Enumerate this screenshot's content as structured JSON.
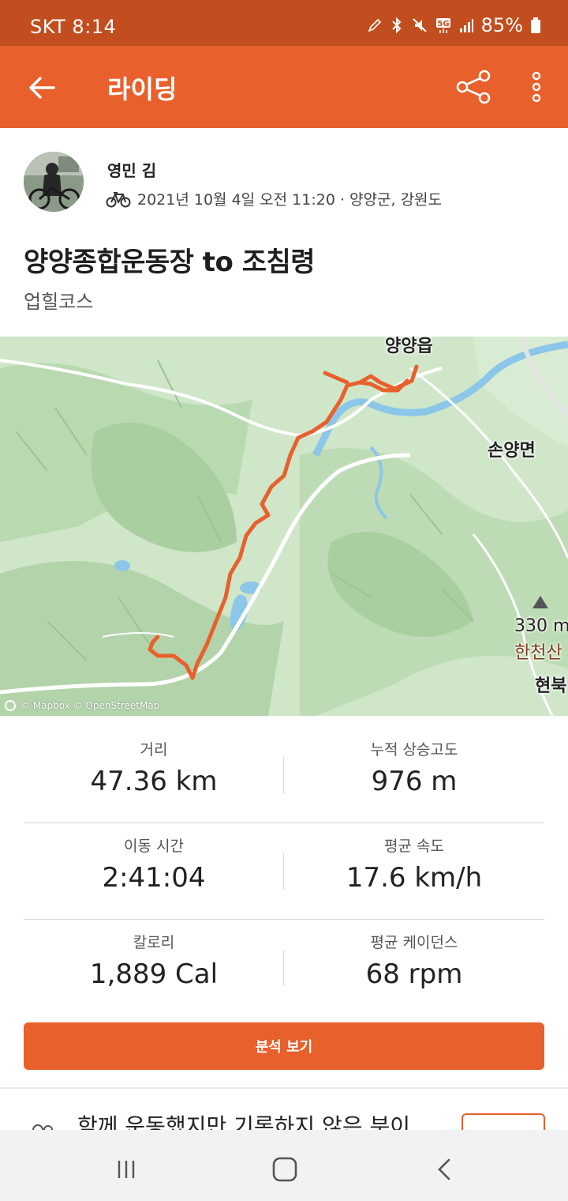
{
  "status_bar": {
    "carrier": "SKT",
    "time": "8:14",
    "battery": "85%",
    "icons": [
      "pen-icon",
      "bluetooth-icon",
      "mute-icon",
      "5g-icon",
      "signal-icon",
      "battery-icon"
    ]
  },
  "app_bar": {
    "title": "라이딩",
    "back_icon": "arrow-left-icon",
    "share_icon": "share-icon",
    "more_icon": "more-vertical-icon"
  },
  "activity": {
    "athlete_name": "영민 김",
    "sport_icon": "bicycle-icon",
    "meta": "2021년 10월 4일 오전 11:20 · 양양군, 강원도",
    "title": "양양종합운동장 to 조침령",
    "description": "업힐코스"
  },
  "map": {
    "labels": {
      "town": "양양읍",
      "district": "손양면",
      "peak_elevation": "330 m",
      "peak_name": "한천산",
      "area": "현북"
    },
    "attribution": "© Mapbox © OpenStreetMap",
    "route_color": "#e8602c"
  },
  "stats": [
    {
      "left": {
        "label": "거리",
        "value": "47.36 km"
      },
      "right": {
        "label": "누적 상승고도",
        "value": "976 m"
      }
    },
    {
      "left": {
        "label": "이동 시간",
        "value": "2:41:04"
      },
      "right": {
        "label": "평균 속도",
        "value": "17.6 km/h"
      }
    },
    {
      "left": {
        "label": "칼로리",
        "value": "1,889 Cal"
      },
      "right": {
        "label": "평균 케이던스",
        "value": "68 rpm"
      }
    }
  ],
  "analysis_button": "분석 보기",
  "invite": {
    "text": "함께 운동했지만 기록하지 않은 분이",
    "icon": "people-icon"
  },
  "nav": {
    "recents_icon": "recents-icon",
    "home_icon": "home-icon",
    "back_icon": "nav-back-icon"
  },
  "colors": {
    "accent": "#e8602c",
    "status_bar": "#c24e1f"
  }
}
